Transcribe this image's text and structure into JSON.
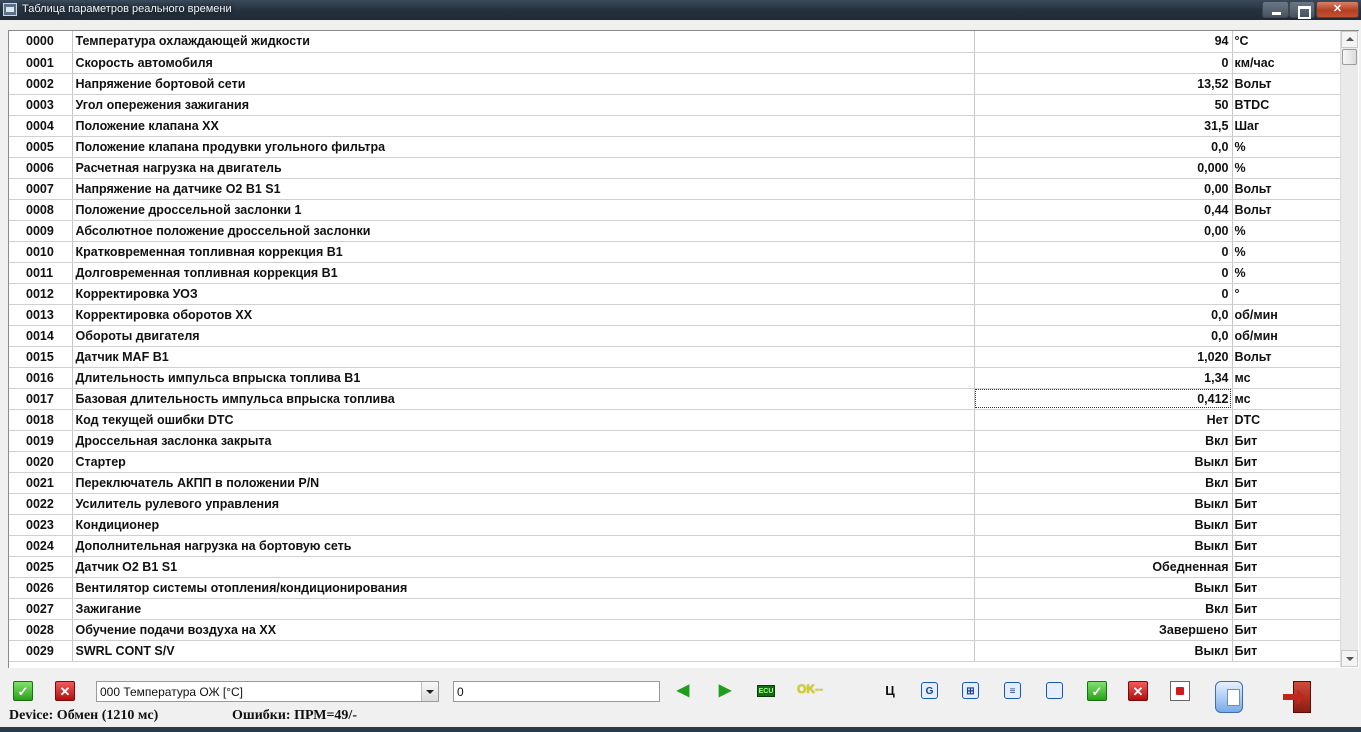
{
  "window": {
    "title": "Таблица параметров реального времени"
  },
  "grid": {
    "rows": [
      {
        "code": "0000",
        "name": "Температура охлаждающей жидкости",
        "value": "94",
        "unit": "°C"
      },
      {
        "code": "0001",
        "name": "Скорость автомобиля",
        "value": "0",
        "unit": "км/час"
      },
      {
        "code": "0002",
        "name": "Напряжение бортовой сети",
        "value": "13,52",
        "unit": "Вольт"
      },
      {
        "code": "0003",
        "name": "Угол опережения зажигания",
        "value": "50",
        "unit": "BTDC"
      },
      {
        "code": "0004",
        "name": "Положение клапана XX",
        "value": "31,5",
        "unit": "Шаг"
      },
      {
        "code": "0005",
        "name": "Положение клапана продувки угольного фильтра",
        "value": "0,0",
        "unit": "%"
      },
      {
        "code": "0006",
        "name": "Расчетная нагрузка на двигатель",
        "value": "0,000",
        "unit": "%"
      },
      {
        "code": "0007",
        "name": "Напряжение на датчике O2 B1 S1",
        "value": "0,00",
        "unit": "Вольт"
      },
      {
        "code": "0008",
        "name": "Положение дроссельной заслонки 1",
        "value": "0,44",
        "unit": "Вольт"
      },
      {
        "code": "0009",
        "name": "Абсолютное положение дроссельной заслонки",
        "value": "0,00",
        "unit": "%"
      },
      {
        "code": "0010",
        "name": "Кратковременная топливная коррекция B1",
        "value": "0",
        "unit": "%"
      },
      {
        "code": "0011",
        "name": "Долговременная топливная коррекция B1",
        "value": "0",
        "unit": "%"
      },
      {
        "code": "0012",
        "name": "Корректировка УОЗ",
        "value": "0",
        "unit": "°"
      },
      {
        "code": "0013",
        "name": "Корректировка оборотов XX",
        "value": "0,0",
        "unit": "об/мин"
      },
      {
        "code": "0014",
        "name": "Обороты двигателя",
        "value": "0,0",
        "unit": "об/мин"
      },
      {
        "code": "0015",
        "name": "Датчик MAF B1",
        "value": "1,020",
        "unit": "Вольт"
      },
      {
        "code": "0016",
        "name": "Длительность импульса впрыска топлива B1",
        "value": "1,34",
        "unit": "мс"
      },
      {
        "code": "0017",
        "name": "Базовая длительность импульса впрыска топлива",
        "value": "0,412",
        "unit": "мс",
        "focused": true
      },
      {
        "code": "0018",
        "name": "Код текущей ошибки DTC",
        "value": "Нет",
        "unit": "DTC"
      },
      {
        "code": "0019",
        "name": "Дроссельная заслонка закрыта",
        "value": "Вкл",
        "unit": "Бит"
      },
      {
        "code": "0020",
        "name": "Стартер",
        "value": "Выкл",
        "unit": "Бит"
      },
      {
        "code": "0021",
        "name": "Переключатель АКПП в положении P/N",
        "value": "Вкл",
        "unit": "Бит"
      },
      {
        "code": "0022",
        "name": "Усилитель рулевого управления",
        "value": "Выкл",
        "unit": "Бит"
      },
      {
        "code": "0023",
        "name": "Кондиционер",
        "value": "Выкл",
        "unit": "Бит"
      },
      {
        "code": "0024",
        "name": "Дополнительная нагрузка на бортовую сеть",
        "value": "Выкл",
        "unit": "Бит"
      },
      {
        "code": "0025",
        "name": "Датчик O2 B1 S1",
        "value": "Обедненная",
        "unit": "Бит"
      },
      {
        "code": "0026",
        "name": "Вентилятор системы отопления/кондиционирования",
        "value": "Выкл",
        "unit": "Бит"
      },
      {
        "code": "0027",
        "name": "Зажигание",
        "value": "Вкл",
        "unit": "Бит"
      },
      {
        "code": "0028",
        "name": "Обучение подачи воздуха на XX",
        "value": "Завершено",
        "unit": "Бит"
      },
      {
        "code": "0029",
        "name": "SWRL CONT S/V",
        "value": "Выкл",
        "unit": "Бит"
      }
    ]
  },
  "toolbar": {
    "param_select_value": "000 Температура ОЖ [°C]",
    "param_input_value": "0",
    "ok_indicator": "OK--",
    "icons": {
      "accept": "check-icon",
      "reject": "x-icon",
      "prev": "arrow-left-icon",
      "next": "arrow-right-icon",
      "ecu": "ecu-icon",
      "c_letter": "Ц",
      "g_letter": "G"
    },
    "colors": {
      "accept": "#2aa11a",
      "reject": "#b30f0f",
      "ok_indicator": "#d7d40f"
    }
  },
  "status": {
    "device": "Device: Обмен (1210 мс)",
    "errors": "Ошибки: ПРМ=49/-"
  }
}
